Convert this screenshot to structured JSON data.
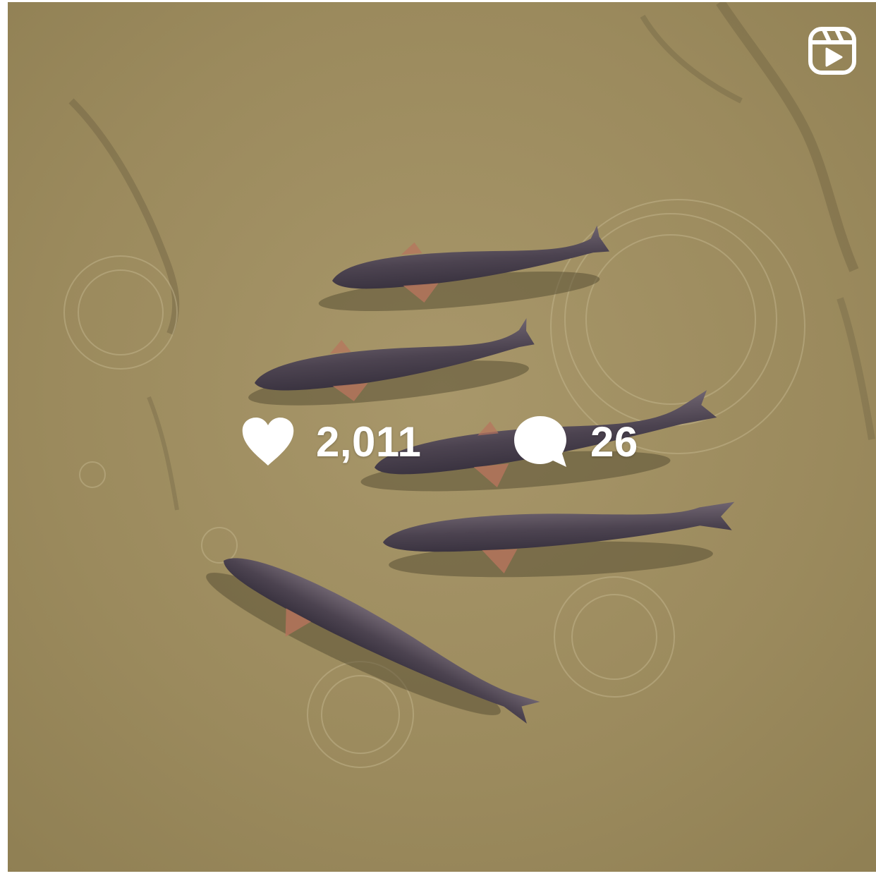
{
  "post": {
    "media_type_icon": "reels-icon",
    "likes_icon": "heart-icon",
    "likes_count": "2,011",
    "comments_icon": "comment-bubble-icon",
    "comments_count": "26",
    "overlay_text_color": "#ffffff"
  }
}
